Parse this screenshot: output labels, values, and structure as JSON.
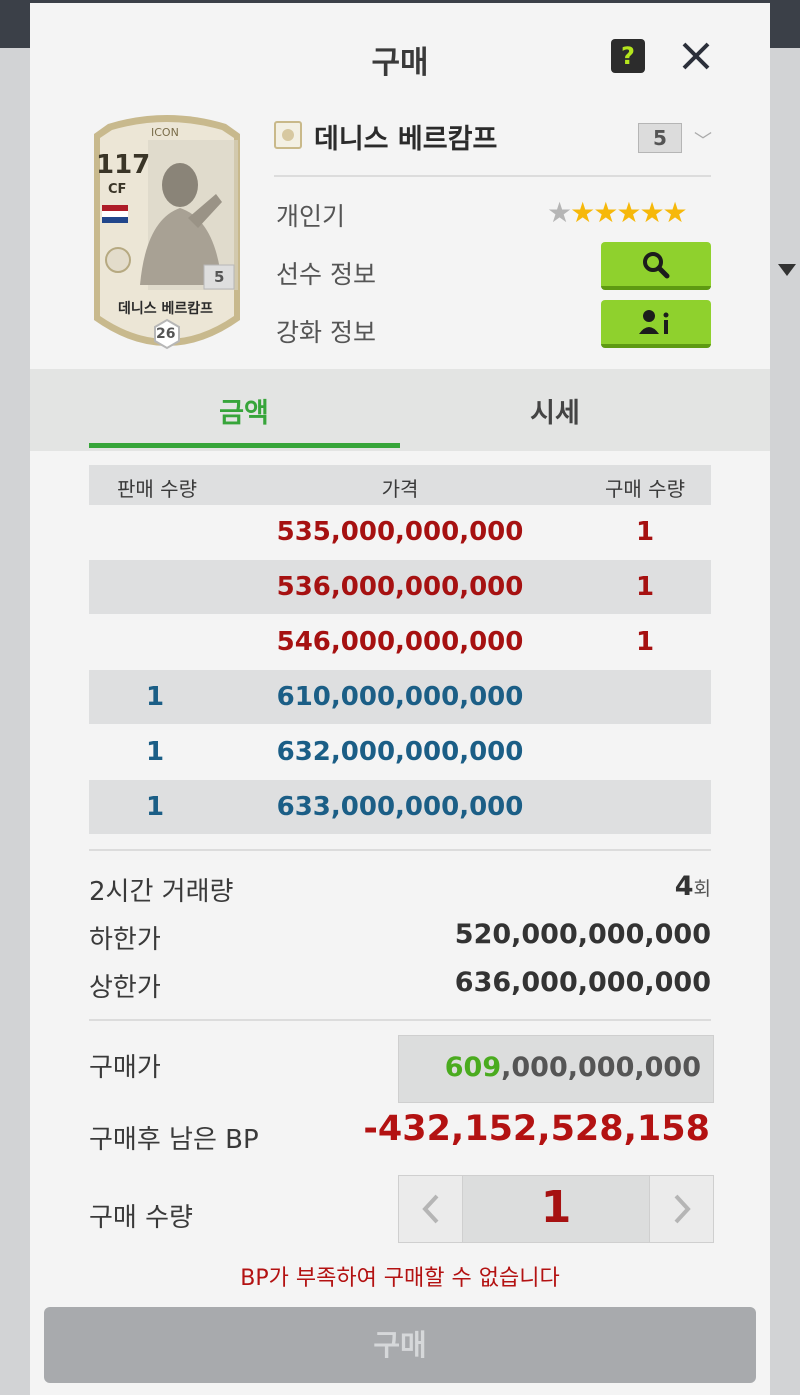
{
  "modal": {
    "title": "구매",
    "help_label": "?",
    "close_icon": "close-icon"
  },
  "card": {
    "header": "ICON",
    "ovr": "117",
    "position": "CF",
    "nation_flag": "netherlands-flag",
    "grade": "5",
    "name": "데니스 베르캄프",
    "season_number": "26",
    "colors": {
      "frame": "#c8b98d",
      "body": "#ece6d6"
    }
  },
  "player": {
    "name": "데니스 베르캄프",
    "grade_selected": "5",
    "popularity_label": "개인기",
    "stars_total": 6,
    "stars_filled": 5,
    "player_info_label": "선수 정보",
    "upgrade_info_label": "강화 정보"
  },
  "tabs": [
    {
      "label": "금액",
      "active": true
    },
    {
      "label": "시세",
      "active": false
    }
  ],
  "table": {
    "headers": {
      "sell_qty": "판매 수량",
      "price": "가격",
      "buy_qty": "구매 수량"
    },
    "rows": [
      {
        "sell_qty": "",
        "price": "535,000,000,000",
        "buy_qty": "1",
        "side": "buy"
      },
      {
        "sell_qty": "",
        "price": "536,000,000,000",
        "buy_qty": "1",
        "side": "buy"
      },
      {
        "sell_qty": "",
        "price": "546,000,000,000",
        "buy_qty": "1",
        "side": "buy"
      },
      {
        "sell_qty": "1",
        "price": "610,000,000,000",
        "buy_qty": "",
        "side": "sell"
      },
      {
        "sell_qty": "1",
        "price": "632,000,000,000",
        "buy_qty": "",
        "side": "sell"
      },
      {
        "sell_qty": "1",
        "price": "633,000,000,000",
        "buy_qty": "",
        "side": "sell"
      }
    ]
  },
  "stats": {
    "volume_label": "2시간 거래량",
    "volume_value": "4",
    "volume_unit": "회",
    "min_label": "하한가",
    "min_value": "520,000,000,000",
    "max_label": "상한가",
    "max_value": "636,000,000,000"
  },
  "purchase": {
    "price_label": "구매가",
    "price_highlight": "609",
    "price_rest": ",000,000,000",
    "remaining_label": "구매후 남은 BP",
    "remaining_value": "-432,152,528,158",
    "qty_label": "구매 수량",
    "qty_value": "1",
    "warning": "BP가 부족하여 구매할 수 없습니다",
    "buy_button": "구매"
  },
  "colors": {
    "accent_green": "#37a53a",
    "button_green": "#8fd12d",
    "buy_red": "#a61111",
    "sell_blue": "#1b5e86"
  }
}
